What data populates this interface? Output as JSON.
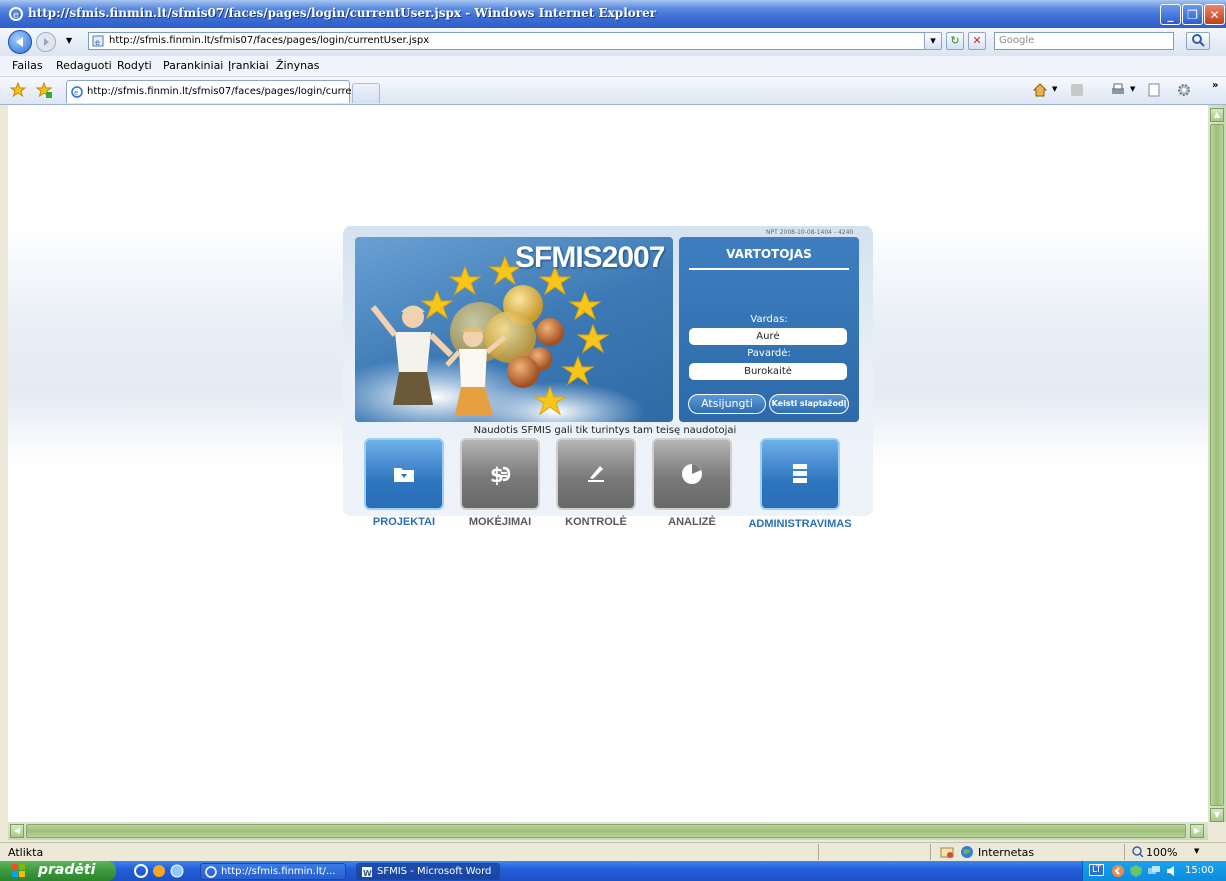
{
  "window": {
    "title": "http://sfmis.finmin.lt/sfmis07/faces/pages/login/currentUser.jspx - Windows Internet Explorer"
  },
  "address": {
    "url": "http://sfmis.finmin.lt/sfmis07/faces/pages/login/currentUser.jspx",
    "search_placeholder": "Google"
  },
  "menu": [
    "Failas",
    "Redaguoti",
    "Rodyti",
    "Parankiniai",
    "Įrankiai",
    "Žinynas"
  ],
  "tab": {
    "label": "http://sfmis.finmin.lt/sfmis07/faces/pages/login/curre..."
  },
  "hero": {
    "title": "SFMIS2007"
  },
  "version": "NPT 2008-10-08-1404 - 4240",
  "user": {
    "title": "VARTOTOJAS",
    "first_name_label": "Vardas:",
    "first_name": "Aurė",
    "last_name_label": "Pavardė:",
    "last_name": "Burokaitė",
    "logout_label": "Atsijungti",
    "change_password_label": "Keisti slaptažodį"
  },
  "notice": "Naudotis SFMIS gali tik turintys tam teisę naudotojai",
  "modules": [
    {
      "label": "PROJEKTAI",
      "state": "active"
    },
    {
      "label": "MOKĖJIMAI",
      "state": "inactive"
    },
    {
      "label": "KONTROLĖ",
      "state": "inactive"
    },
    {
      "label": "ANALIZĖ",
      "state": "inactive"
    },
    {
      "label": "ADMINISTRAVIMAS",
      "state": "active"
    }
  ],
  "status": {
    "text": "Atlikta",
    "zone": "Internetas",
    "zoom": "100%"
  },
  "taskbar": {
    "start_label": "pradėti",
    "tasks": [
      "http://sfmis.finmin.lt/...",
      "SFMIS - Microsoft Word"
    ],
    "lang": "LT",
    "clock": "15:00"
  },
  "colors": {
    "accent_blue": "#2a6fb6",
    "panel_blue": "#3f7fbf",
    "module_gray": "#7a7a7a",
    "xp_taskbar": "#245edb"
  }
}
